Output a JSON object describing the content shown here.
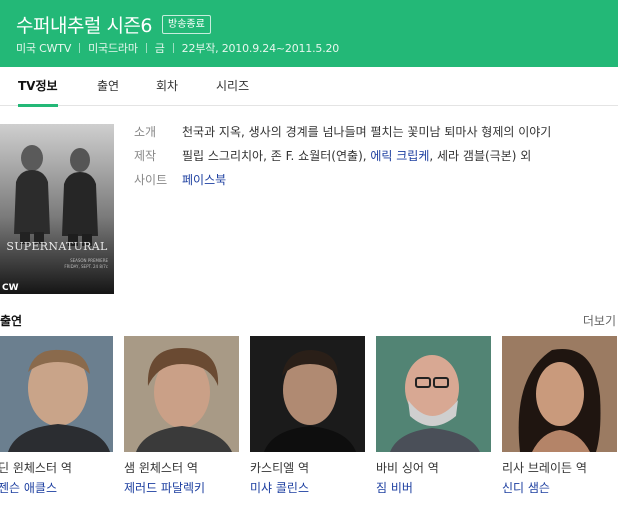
{
  "header": {
    "title": "수퍼내추럴 시즌6",
    "badge": "방송종료",
    "meta": [
      "미국 CWTV",
      "미국드라마",
      "금",
      "22부작, 2010.9.24~2011.5.20"
    ]
  },
  "tabs": [
    {
      "label": "TV정보",
      "active": true
    },
    {
      "label": "출연",
      "active": false
    },
    {
      "label": "회차",
      "active": false
    },
    {
      "label": "시리즈",
      "active": false
    }
  ],
  "poster": {
    "title_text": "SUPERNATURAL",
    "premiere_line1": "SEASON PREMIERE",
    "premiere_line2": "FRIDAY, SEPT. 24 8/7c",
    "network": "CW"
  },
  "info": {
    "intro_label": "소개",
    "intro_value": "천국과 지옥, 생사의 경계를 넘나들며 펼치는 꽃미남 퇴마사 형제의 이야기",
    "production_label": "제작",
    "production_plain": "필립 스그리치아, 존 F. 쇼월터(연출), ",
    "production_link": "에릭 크립케",
    "production_tail": ", 세라 갬블(극본) 외",
    "site_label": "사이트",
    "site_value": "페이스북"
  },
  "cast": {
    "title": "출연",
    "more": "더보기",
    "members": [
      {
        "role": "딘 윈체스터 역",
        "actor": "젠슨 애클스"
      },
      {
        "role": "샘 윈체스터 역",
        "actor": "제러드 파달렉키"
      },
      {
        "role": "카스티엘 역",
        "actor": "미샤 콜린스"
      },
      {
        "role": "바비 싱어 역",
        "actor": "짐 비버"
      },
      {
        "role": "리사 브레이든 역",
        "actor": "신디 샘슨"
      }
    ]
  },
  "colors": {
    "accent": "#23b877",
    "link": "#1d3fa0"
  }
}
